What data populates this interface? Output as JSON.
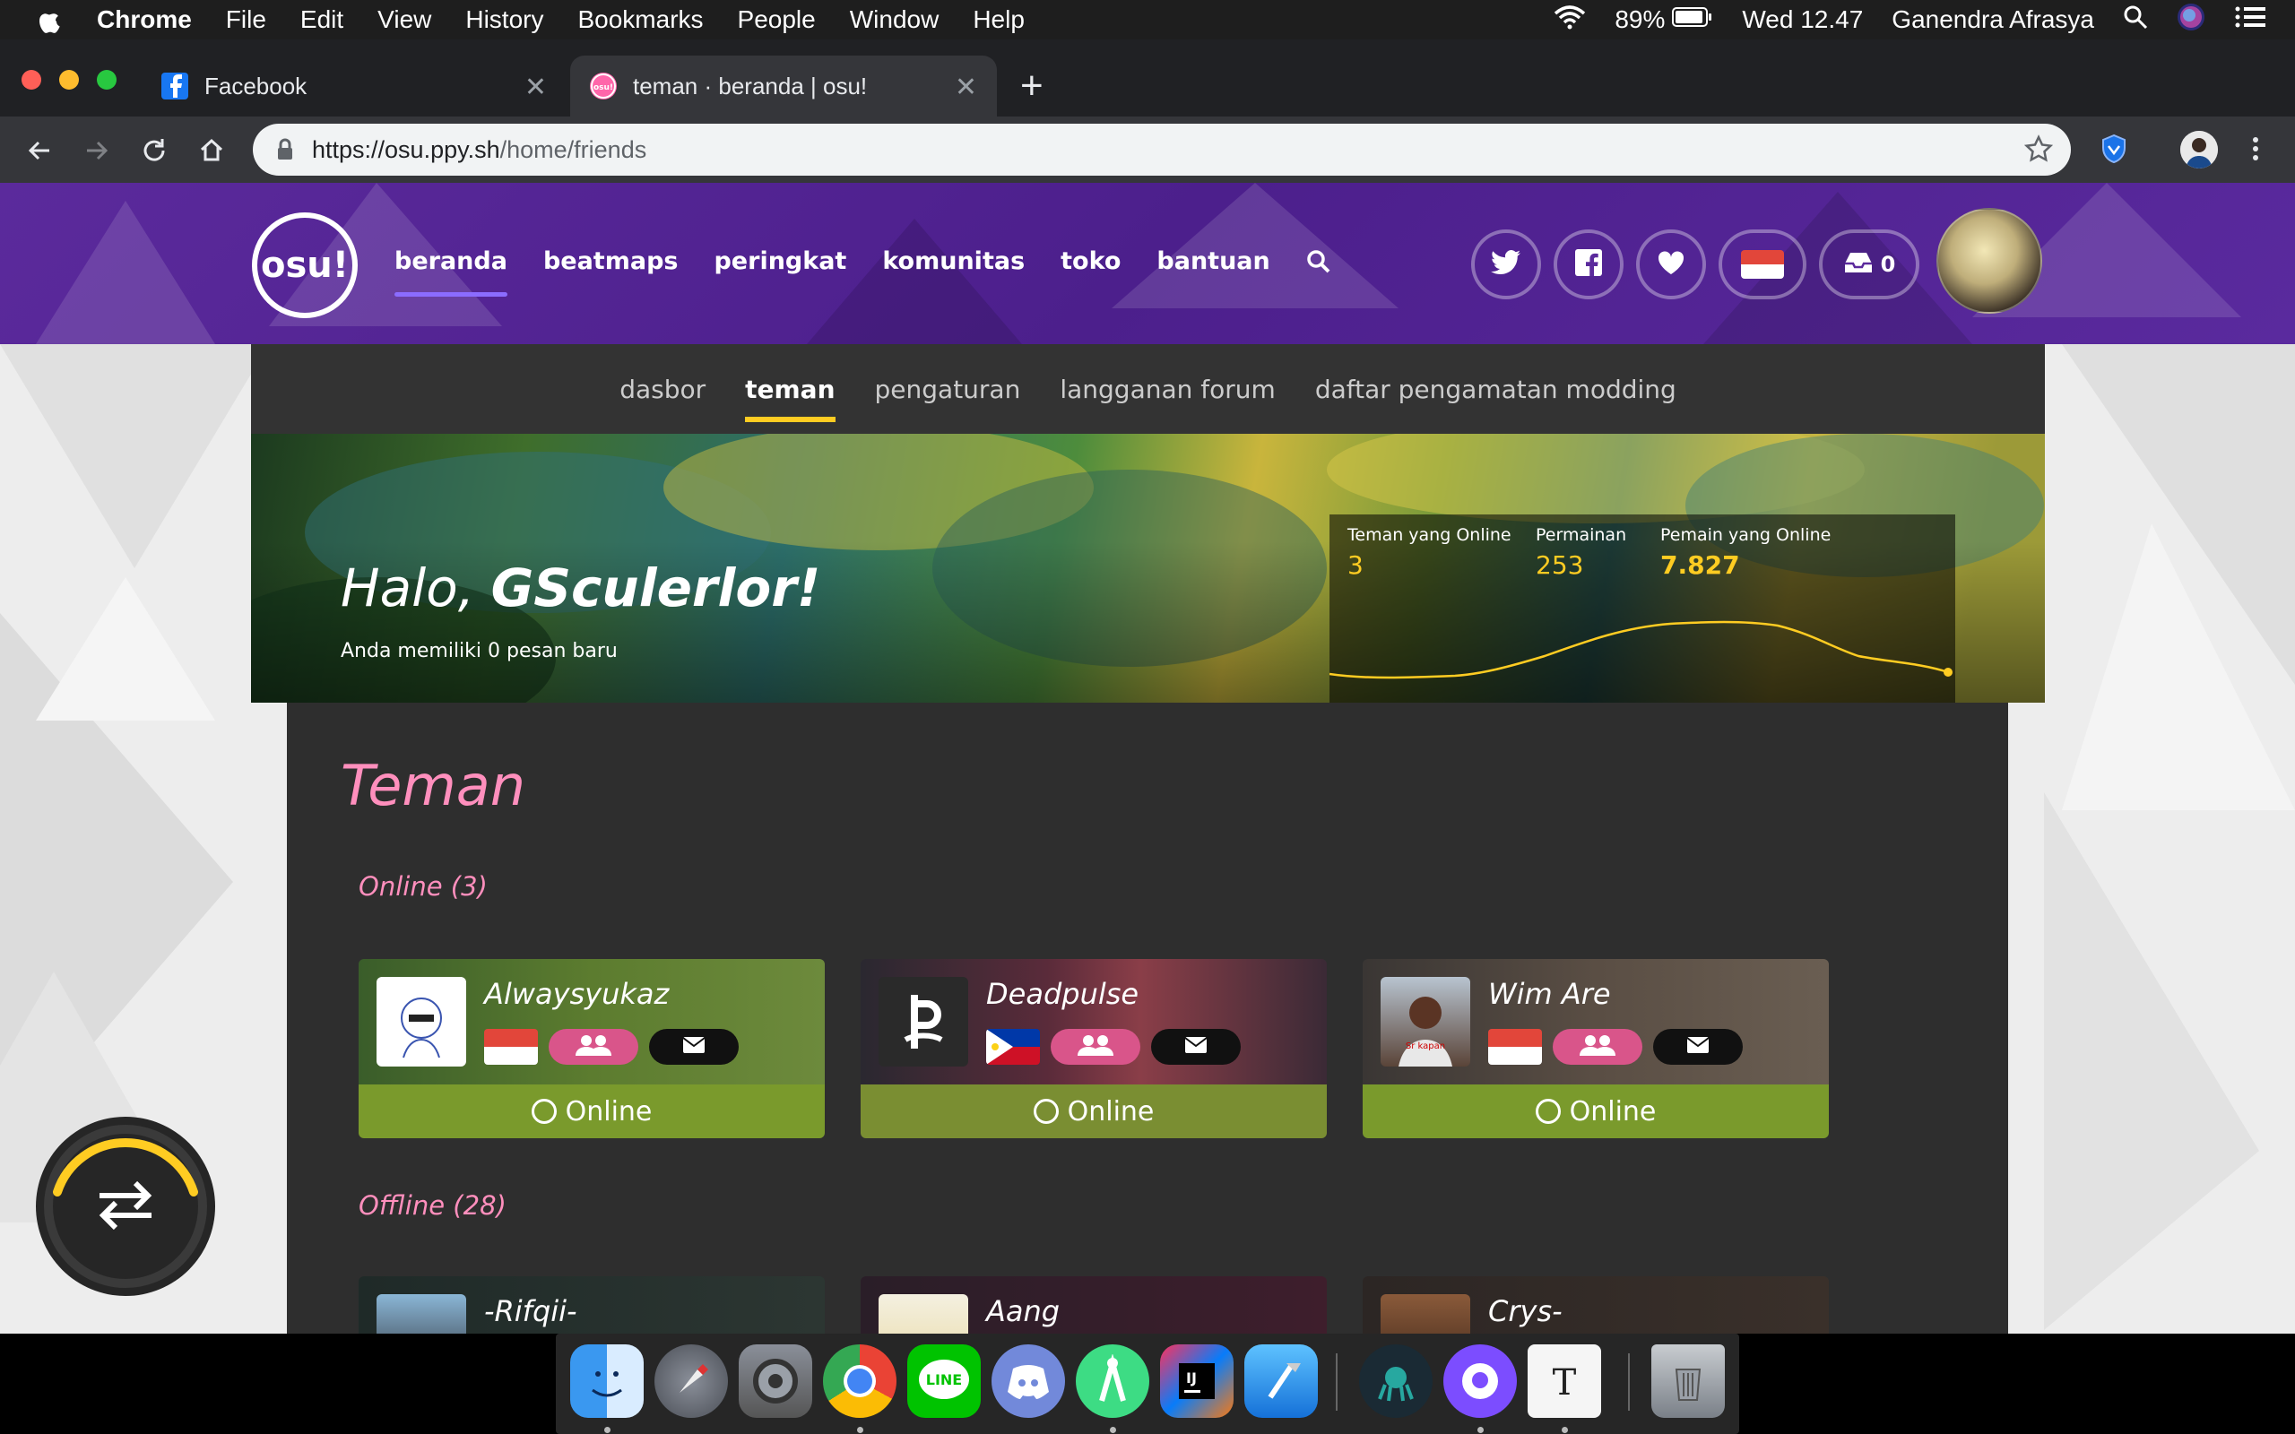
{
  "menubar": {
    "app": "Chrome",
    "items": [
      "File",
      "Edit",
      "View",
      "History",
      "Bookmarks",
      "People",
      "Window",
      "Help"
    ],
    "battery": "89%",
    "clock": "Wed 12.47",
    "user": "Ganendra Afrasya"
  },
  "tabs": [
    {
      "title": "Facebook",
      "icon": "facebook-icon",
      "active": false
    },
    {
      "title": "teman · beranda | osu!",
      "icon": "osu-icon",
      "active": true
    }
  ],
  "toolbar": {
    "url_host": "https://osu.ppy.sh",
    "url_path": "/home/friends"
  },
  "osu_nav": {
    "logo": "osu!",
    "items": [
      "beranda",
      "beatmaps",
      "peringkat",
      "komunitas",
      "toko",
      "bantuan"
    ],
    "active": "beranda",
    "notifications": "0"
  },
  "subnav": {
    "items": [
      "dasbor",
      "teman",
      "pengaturan",
      "langganan forum",
      "daftar pengamatan modding"
    ],
    "active": "teman"
  },
  "hero": {
    "greeting": "Halo, ",
    "username": "GSculerlor!",
    "subtitle": "Anda memiliki 0 pesan baru",
    "stats": [
      {
        "label": "Teman yang Online",
        "value": "3"
      },
      {
        "label": "Permainan",
        "value": "253"
      },
      {
        "label": "Pemain yang Online",
        "value": "7.827"
      }
    ],
    "chart_color": "#ffcc22"
  },
  "friends": {
    "title": "Teman",
    "online_label": "Online (3)",
    "offline_label": "Offline (28)",
    "status_online": "Online",
    "online": [
      {
        "name": "Alwaysyukaz",
        "flag": "Indonesia"
      },
      {
        "name": "Deadpulse",
        "flag": "Philippines"
      },
      {
        "name": "Wim Are",
        "flag": "Indonesia"
      }
    ],
    "offline": [
      {
        "name": "-Rifqii-"
      },
      {
        "name": "Aang"
      },
      {
        "name": "Crys-"
      }
    ]
  },
  "colors": {
    "osu_purple": "#5b2a9c",
    "accent_pink": "#ff8fbd",
    "accent_yellow": "#ffcc22",
    "online_green": "#7a9a2c"
  }
}
